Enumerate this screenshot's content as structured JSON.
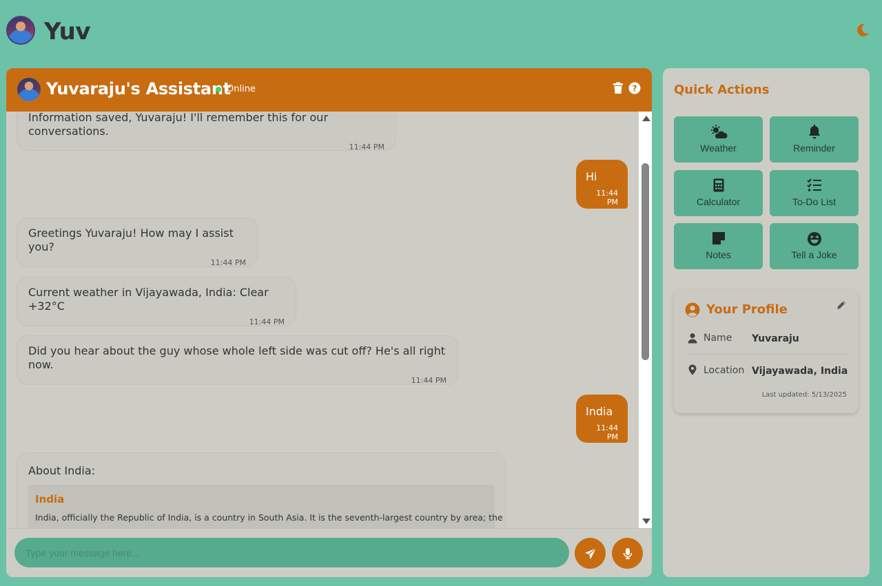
{
  "app": {
    "title": "Yuv"
  },
  "chat": {
    "assistant_name": "Yuvaraju's Assistant",
    "status": "Online",
    "messages": [
      {
        "from": "bot",
        "text": "Information saved, Yuvaraju! I'll remember this for our conversations.",
        "time": "11:44 PM"
      },
      {
        "from": "user",
        "text": "Hi",
        "time": "11:44 PM"
      },
      {
        "from": "bot",
        "text": "Greetings Yuvaraju! How may I assist you?",
        "time": "11:44 PM"
      },
      {
        "from": "bot",
        "text": "Current weather in Vijayawada, India: Clear +32°C",
        "time": "11:44 PM"
      },
      {
        "from": "bot",
        "text": "Did you hear about the guy whose whole left side was cut off? He's all right now.",
        "time": "11:44 PM"
      },
      {
        "from": "user",
        "text": "India",
        "time": "11:44 PM"
      },
      {
        "from": "bot",
        "text": "About India:",
        "card_title": "India",
        "card_text": "India, officially the Republic of India, is a country in South Asia. It is the seventh-largest country by area; the"
      }
    ],
    "input_placeholder": "Type your message here..."
  },
  "quick_actions": {
    "title": "Quick Actions",
    "items": [
      {
        "label": "Weather",
        "icon": "weather-icon"
      },
      {
        "label": "Reminder",
        "icon": "bell-icon"
      },
      {
        "label": "Calculator",
        "icon": "calculator-icon"
      },
      {
        "label": "To-Do List",
        "icon": "checklist-icon"
      },
      {
        "label": "Notes",
        "icon": "note-icon"
      },
      {
        "label": "Tell a Joke",
        "icon": "laugh-icon"
      }
    ]
  },
  "profile": {
    "title": "Your Profile",
    "name_label": "Name",
    "name_value": "Yuvaraju",
    "location_label": "Location",
    "location_value": "Vijayawada, India",
    "updated": "Last updated: 5/13/2025"
  },
  "colors": {
    "accent": "#c86c12",
    "background": "#6cc2a7",
    "panel": "#cdcdc6",
    "button": "#5aae91"
  }
}
